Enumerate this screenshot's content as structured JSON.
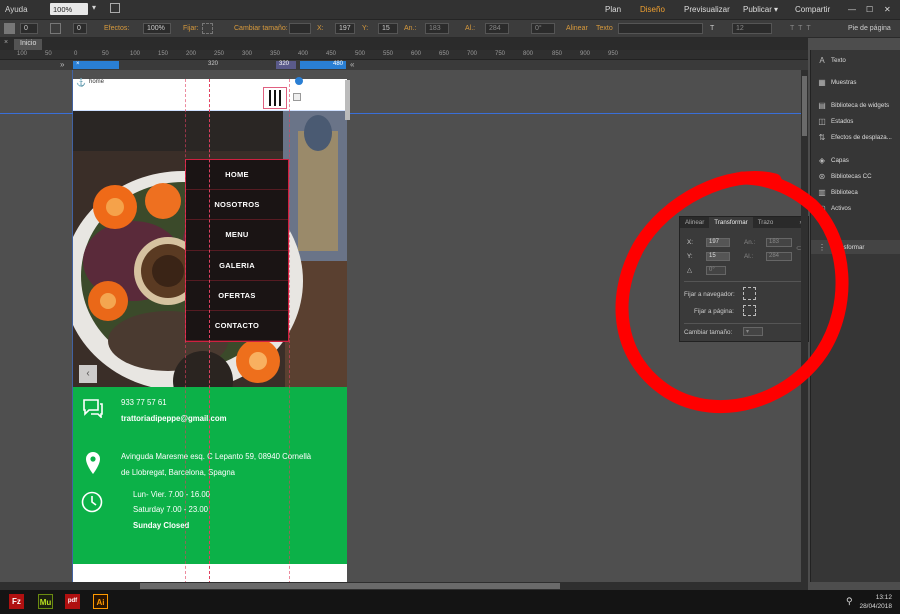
{
  "menubar": {
    "help": "Ayuda",
    "zoom": "100%",
    "modes": [
      "Plan",
      "Diseño",
      "Previsualizar",
      "Publicar",
      "Compartir"
    ],
    "active_mode": "Diseño"
  },
  "options_bar": {
    "stroke_val": "0",
    "effects_label": "Efectos:",
    "effects_val": "100%",
    "pin_label": "Fijar:",
    "resize_label": "Cambiar tamaño:",
    "x_label": "X:",
    "x_val": "197",
    "y_label": "Y:",
    "y_val": "15",
    "w_label": "An.:",
    "w_val": "183",
    "h_label": "Al.:",
    "h_val": "284",
    "rot_val": "0°",
    "align_label": "Alinear",
    "text_label": "Texto",
    "font_size": "12",
    "footer_label": "Pie de página"
  },
  "tabs": {
    "home_tab": "Inicio"
  },
  "ruler": {
    "marks": [
      "100",
      "50",
      "0",
      "50",
      "100",
      "150",
      "200",
      "250",
      "300",
      "350",
      "400",
      "450",
      "500",
      "550",
      "600",
      "650",
      "700",
      "750",
      "800",
      "850",
      "900",
      "950"
    ]
  },
  "breakpoints": {
    "mid": "320",
    "a": "320",
    "b": "480"
  },
  "page": {
    "page_label": "home",
    "menu_items": [
      "HOME",
      "NOSOTROS",
      "MENU",
      "GALERIA",
      "OFERTAS",
      "CONTACTO"
    ],
    "phone": "933 77 57 61",
    "email": "trattoriadipeppe@gmail.com",
    "address_line1": "Avinguda Maresme esq. C Lepanto 59, 08940 Cornellà",
    "address_line2": "de Llobregat, Barcelona, Spagna",
    "hours1": "Lun- Vier. 7.00 - 16.00",
    "hours2": "Saturday  7.00 - 23.00",
    "hours3": "Sunday Closed",
    "slider_prev": "‹"
  },
  "transform_panel": {
    "tabs": [
      "Alinear",
      "Transformar",
      "Trazo"
    ],
    "active_tab": "Transformar",
    "x_label": "X:",
    "x_val": "197",
    "y_label": "Y:",
    "y_val": "15",
    "w_label": "An.:",
    "w_val": "183",
    "h_label": "Al.:",
    "h_val": "284",
    "rot_val": "0°",
    "pin_browser": "Fijar a navegador:",
    "pin_page": "Fijar a página:",
    "resize": "Cambiar tamaño:"
  },
  "right_panel": {
    "items": [
      "Texto",
      "Muestras",
      "Biblioteca de widgets",
      "Estados",
      "Efectos de desplaza...",
      "Capas",
      "Bibliotecas CC",
      "Biblioteca",
      "Activos",
      "Transformar"
    ]
  },
  "taskbar": {
    "apps": [
      "Fz",
      "Mu",
      "pdf",
      "Ai"
    ],
    "time": "13:12",
    "date": "28/04/2018"
  },
  "colors": {
    "footer_green": "#0cb148",
    "menu_bg": "#1a1414",
    "accent_orange": "#f0a030",
    "annotation_red": "#ff0000"
  }
}
